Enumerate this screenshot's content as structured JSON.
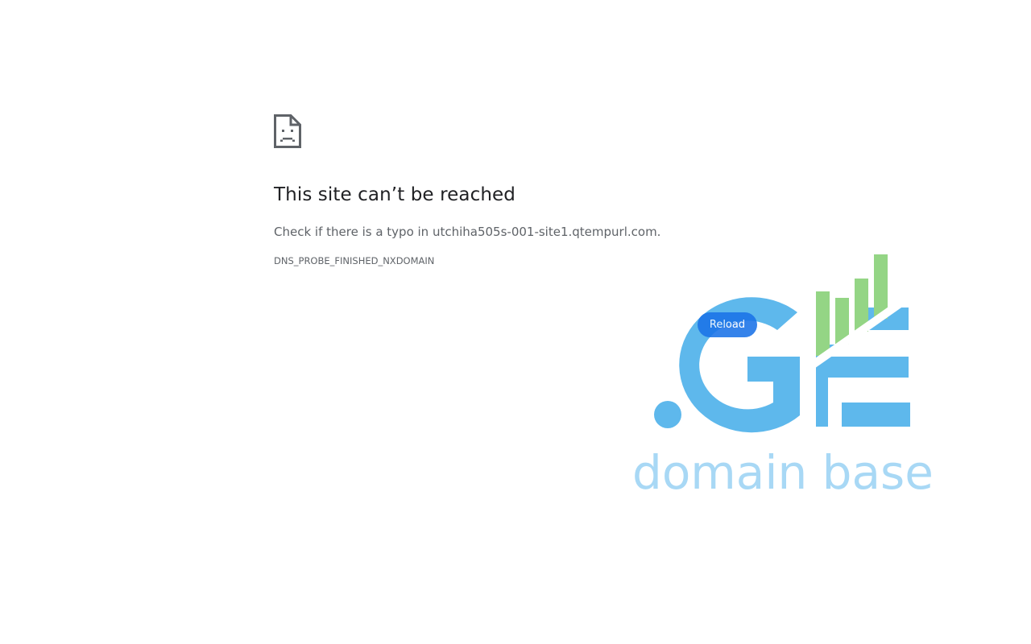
{
  "error": {
    "title": "This site can’t be reached",
    "message": "Check if there is a typo in utchiha505s-001-site1.qtempurl.com.",
    "code": "DNS_PROBE_FINISHED_NXDOMAIN",
    "icon": "sad-page-icon"
  },
  "actions": {
    "reload_label": "Reload"
  },
  "overlay_logo": {
    "mark": ".GE",
    "tagline": "domain base",
    "colors": {
      "blue": "#5eb8ec",
      "green": "#94d585",
      "tagline": "#a8d8f5"
    }
  },
  "colors": {
    "title": "#202124",
    "secondary_text": "#5f6368",
    "button": "#1a73e8"
  }
}
